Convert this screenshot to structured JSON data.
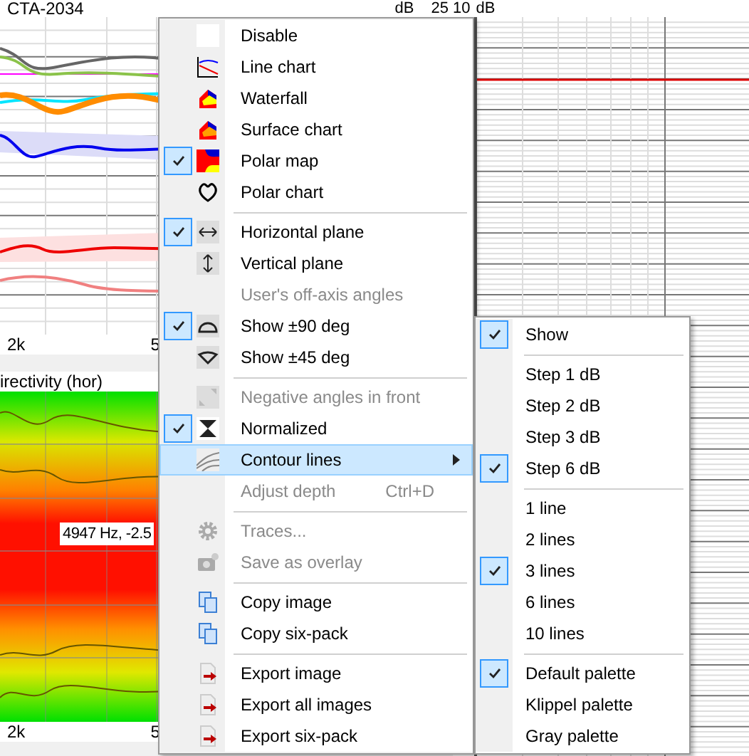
{
  "top_chart": {
    "title": "CTA-2034",
    "unit": "dB",
    "tick": "25",
    "axis_labels": [
      "2k",
      "5"
    ]
  },
  "bottom_chart": {
    "title": "irectivity (hor)",
    "tooltip": "4947 Hz, -2.5",
    "axis_labels": [
      "2k",
      "5"
    ]
  },
  "right_chart": {
    "tick": "10",
    "unit": "dB"
  },
  "menu": {
    "items": [
      {
        "kind": "item",
        "label": "Disable",
        "checked": false,
        "disabled": false,
        "selected": false
      },
      {
        "kind": "item",
        "label": "Line chart",
        "checked": false,
        "disabled": false,
        "selected": false
      },
      {
        "kind": "item",
        "label": "Waterfall",
        "checked": false,
        "disabled": false,
        "selected": false
      },
      {
        "kind": "item",
        "label": "Surface chart",
        "checked": false,
        "disabled": false,
        "selected": false
      },
      {
        "kind": "item",
        "label": "Polar map",
        "checked": true,
        "disabled": false,
        "selected": false
      },
      {
        "kind": "item",
        "label": "Polar chart",
        "checked": false,
        "disabled": false,
        "selected": false
      },
      {
        "kind": "separator"
      },
      {
        "kind": "item",
        "label": "Horizontal plane",
        "checked": true,
        "disabled": false,
        "selected": false
      },
      {
        "kind": "item",
        "label": "Vertical plane",
        "checked": false,
        "disabled": false,
        "selected": false
      },
      {
        "kind": "item",
        "label": "User's off-axis angles",
        "checked": false,
        "disabled": true,
        "selected": false
      },
      {
        "kind": "item",
        "label": "Show ±90 deg",
        "checked": true,
        "disabled": false,
        "selected": false
      },
      {
        "kind": "item",
        "label": "Show ±45 deg",
        "checked": false,
        "disabled": false,
        "selected": false
      },
      {
        "kind": "separator"
      },
      {
        "kind": "item",
        "label": "Negative angles in front",
        "checked": false,
        "disabled": true,
        "selected": false
      },
      {
        "kind": "item",
        "label": "Normalized",
        "checked": true,
        "disabled": false,
        "selected": false
      },
      {
        "kind": "item",
        "label": "Contour lines",
        "checked": false,
        "disabled": false,
        "selected": true,
        "submenu": true
      },
      {
        "kind": "item",
        "label": "Adjust depth",
        "shortcut": "Ctrl+D",
        "checked": false,
        "disabled": true,
        "selected": false
      },
      {
        "kind": "separator"
      },
      {
        "kind": "item",
        "label": "Traces...",
        "checked": false,
        "disabled": true,
        "selected": false
      },
      {
        "kind": "item",
        "label": "Save as overlay",
        "checked": false,
        "disabled": true,
        "selected": false
      },
      {
        "kind": "separator"
      },
      {
        "kind": "item",
        "label": "Copy image",
        "checked": false,
        "disabled": false,
        "selected": false
      },
      {
        "kind": "item",
        "label": "Copy six-pack",
        "checked": false,
        "disabled": false,
        "selected": false
      },
      {
        "kind": "separator"
      },
      {
        "kind": "item",
        "label": "Export image",
        "checked": false,
        "disabled": false,
        "selected": false
      },
      {
        "kind": "item",
        "label": "Export all images",
        "checked": false,
        "disabled": false,
        "selected": false
      },
      {
        "kind": "item",
        "label": "Export six-pack",
        "checked": false,
        "disabled": false,
        "selected": false
      }
    ]
  },
  "submenu": {
    "items": [
      {
        "kind": "item",
        "label": "Show",
        "checked": true
      },
      {
        "kind": "separator"
      },
      {
        "kind": "item",
        "label": "Step 1 dB",
        "checked": false
      },
      {
        "kind": "item",
        "label": "Step 2 dB",
        "checked": false
      },
      {
        "kind": "item",
        "label": "Step 3 dB",
        "checked": false
      },
      {
        "kind": "item",
        "label": "Step 6 dB",
        "checked": true
      },
      {
        "kind": "separator"
      },
      {
        "kind": "item",
        "label": "1 line",
        "checked": false
      },
      {
        "kind": "item",
        "label": "2 lines",
        "checked": false
      },
      {
        "kind": "item",
        "label": "3 lines",
        "checked": true
      },
      {
        "kind": "item",
        "label": "6 lines",
        "checked": false
      },
      {
        "kind": "item",
        "label": "10 lines",
        "checked": false
      },
      {
        "kind": "separator"
      },
      {
        "kind": "item",
        "label": "Default palette",
        "checked": true
      },
      {
        "kind": "item",
        "label": "Klippel palette",
        "checked": false
      },
      {
        "kind": "item",
        "label": "Gray palette",
        "checked": false
      }
    ]
  }
}
